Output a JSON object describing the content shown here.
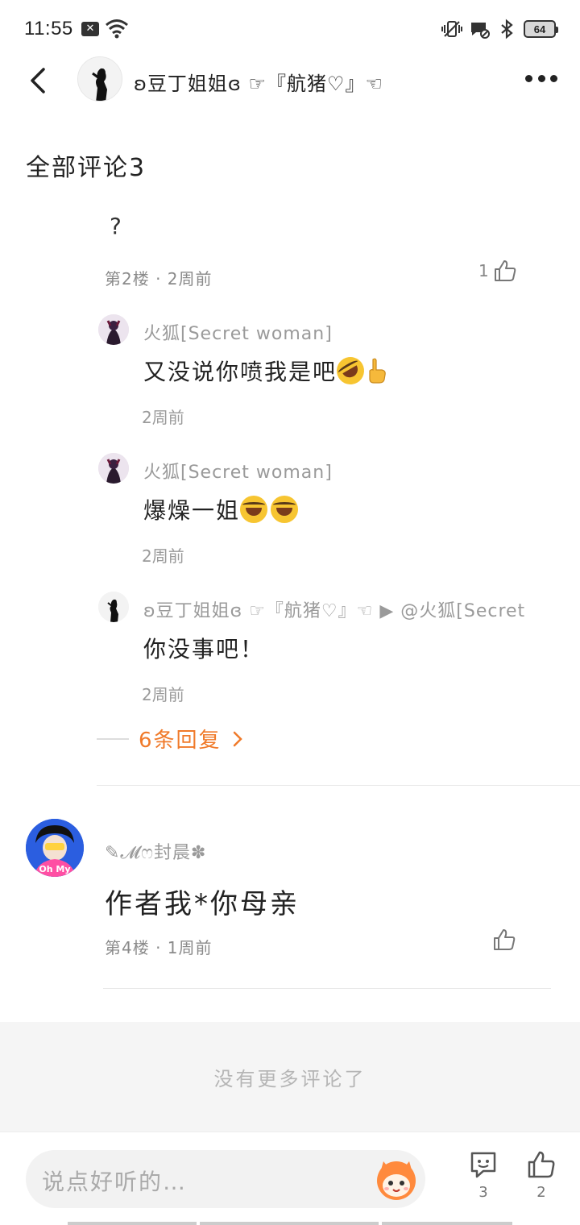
{
  "status_bar": {
    "time": "11:55",
    "battery": "64"
  },
  "header": {
    "title": "ʚ豆丁姐姐ɞ ☞『航猪♡』☜"
  },
  "section_title": "全部评论3",
  "comment_floor2": {
    "text": "?",
    "meta": "第2楼 · 2周前",
    "like_count": "1"
  },
  "replies": [
    {
      "name": "火狐[Secret woman]",
      "text": "又没说你喷我是吧",
      "time": "2周前"
    },
    {
      "name": "火狐[Secret woman]",
      "text": "爆燥一姐",
      "time": "2周前"
    },
    {
      "name": "ʚ豆丁姐姐ɞ ☞『航猪♡』☜ ▶ @火狐[Secret",
      "text": "你没事吧！",
      "time": "2周前"
    }
  ],
  "more_replies": "6条回复",
  "comment_floor4": {
    "name": "✎𝓜ෆ封晨✽",
    "text": "作者我*你母亲",
    "meta": "第4楼 · 1周前"
  },
  "no_more": "没有更多评论了",
  "bottom_bar": {
    "input_placeholder": "说点好听的…",
    "comment_count": "3",
    "like_count": "2"
  },
  "colors": {
    "accent": "#f07a2a",
    "meta_text": "#8a8a8a",
    "background": "#ffffff"
  }
}
